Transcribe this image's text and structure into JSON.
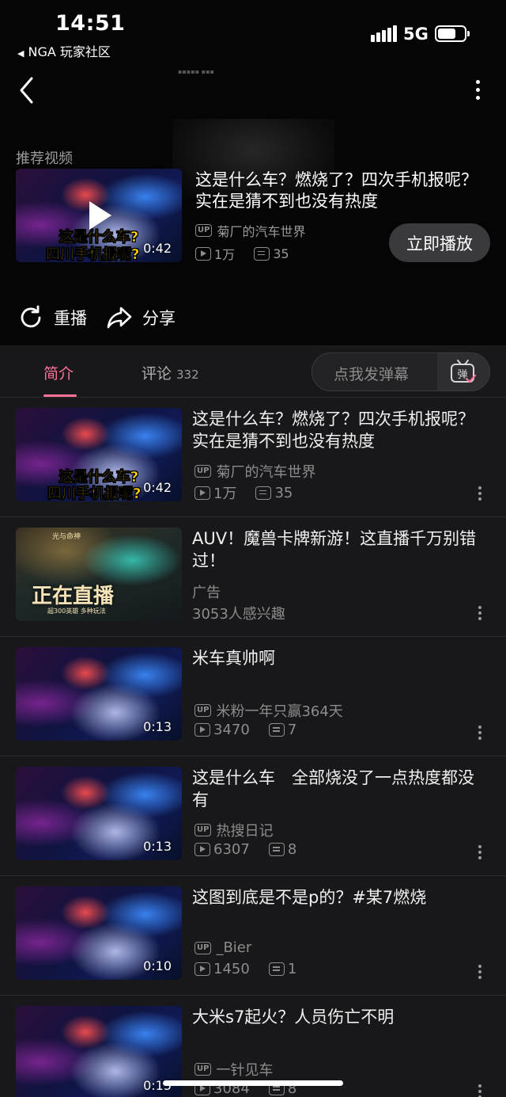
{
  "status_bar": {
    "time": "14:51",
    "back_app": "NGA 玩家社区",
    "network": "5G"
  },
  "player": {
    "recommended_label": "推荐视频",
    "recommended": {
      "title": "这是什么车？燃烧了？四次手机报呢？实在是猜不到也没有热度",
      "thumb_text_line1": "这是什么车?",
      "thumb_text_line2": "四川手机报呢?",
      "duration": "0:42",
      "uploader": "菊厂的汽车世界",
      "views": "1万",
      "danmaku": "35"
    },
    "play_now_label": "立即播放",
    "replay_label": "重播",
    "share_label": "分享"
  },
  "tabs": {
    "intro_label": "简介",
    "comments_label": "评论",
    "comments_count": "332",
    "danmaku_placeholder": "点我发弹幕",
    "danmaku_icon_text": "弹"
  },
  "list": [
    {
      "title": "这是什么车？燃烧了？四次手机报呢？实在是猜不到也没有热度",
      "thumb_text_line1": "这是什么车?",
      "thumb_text_line2": "四川手机报呢?",
      "duration": "0:42",
      "uploader": "菊厂的汽车世界",
      "views": "1万",
      "danmaku": "35"
    },
    {
      "is_ad": true,
      "title": "AUV！魔兽卡牌新游！这直播千万别错过！",
      "ad_label": "广告",
      "interest": "3053人感兴趣",
      "thumb_title": "正在直播",
      "thumb_sub": "超300英雄 多种玩法",
      "thumb_logo": "光与命神"
    },
    {
      "title": "米车真帅啊",
      "duration": "0:13",
      "uploader": "米粉一年只赢364天",
      "views": "3470",
      "danmaku": "7"
    },
    {
      "title": "这是什么车　全部烧没了一点热度都没有",
      "duration": "0:13",
      "uploader": "热搜日记",
      "views": "6307",
      "danmaku": "8"
    },
    {
      "title": "这图到底是不是p的？#某7燃烧",
      "duration": "0:10",
      "uploader": "_Bier",
      "views": "1450",
      "danmaku": "1"
    },
    {
      "title": "大米s7起火？人员伤亡不明",
      "duration": "0:15",
      "uploader": "一针见车",
      "views": "3084",
      "danmaku": "8"
    }
  ]
}
